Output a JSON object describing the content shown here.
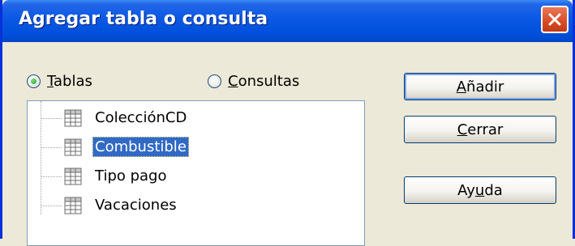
{
  "dialog": {
    "title": "Agregar tabla o consulta",
    "close_icon": "close-icon"
  },
  "radios": [
    {
      "prefix": "",
      "accel": "T",
      "rest": "ablas",
      "checked": true
    },
    {
      "prefix": "",
      "accel": "C",
      "rest": "onsultas",
      "checked": false
    }
  ],
  "list": {
    "items": [
      {
        "label": "ColecciónCD",
        "icon": "table-icon",
        "selected": false
      },
      {
        "label": "Combustible",
        "icon": "table-icon",
        "selected": true
      },
      {
        "label": "Tipo pago",
        "icon": "table-icon",
        "selected": false
      },
      {
        "label": "Vacaciones",
        "icon": "table-icon",
        "selected": false
      }
    ]
  },
  "buttons": {
    "add": {
      "accel": "A",
      "rest": "ñadir"
    },
    "close": {
      "accel": "C",
      "rest": "errar"
    },
    "help": {
      "pre": "Ay",
      "accel": "u",
      "rest": "da"
    }
  },
  "colors": {
    "titlebar": "#0a58e4",
    "selection": "#316ac5",
    "close_button": "#d84c25"
  }
}
